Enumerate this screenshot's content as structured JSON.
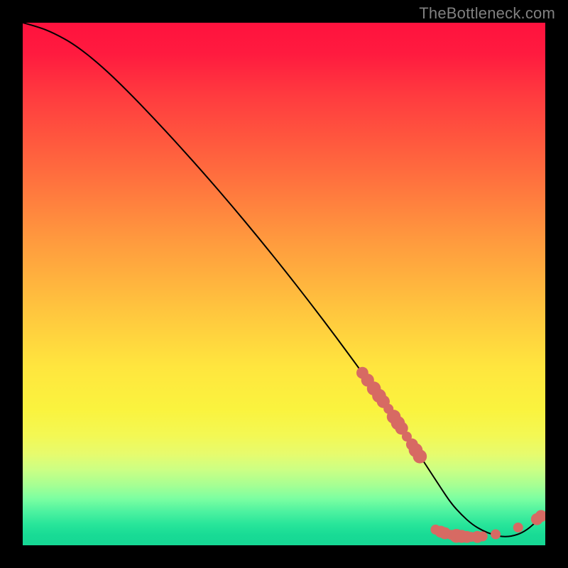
{
  "watermark": "TheBottleneck.com",
  "colors": {
    "marker_fill": "#d76a63",
    "marker_stroke": "#d76a63",
    "curve_stroke": "#000000",
    "frame_bg": "#000000"
  },
  "chart_data": {
    "type": "line",
    "title": "",
    "xlabel": "",
    "ylabel": "",
    "xlim": [
      0,
      100
    ],
    "ylim": [
      0,
      100
    ],
    "grid": false,
    "legend": false,
    "series": [
      {
        "name": "bottleneck-curve",
        "x": [
          0,
          3,
          6,
          10,
          15,
          20,
          25,
          30,
          35,
          40,
          45,
          50,
          55,
          60,
          65,
          70,
          74,
          77,
          80,
          82,
          84,
          86,
          88,
          90,
          92,
          94,
          96,
          98,
          100
        ],
        "y": [
          100,
          99.2,
          98.0,
          95.8,
          91.8,
          87.0,
          81.8,
          76.4,
          70.8,
          65.0,
          59.0,
          52.8,
          46.4,
          39.8,
          33.0,
          26.0,
          20.2,
          15.6,
          11.0,
          8.0,
          5.8,
          4.0,
          2.8,
          2.0,
          1.6,
          1.8,
          2.6,
          4.2,
          6.2
        ]
      }
    ],
    "markers": [
      {
        "x": 65.0,
        "y": 33.0,
        "r": 1.2
      },
      {
        "x": 66.0,
        "y": 31.6,
        "r": 1.3
      },
      {
        "x": 67.2,
        "y": 30.0,
        "r": 1.4
      },
      {
        "x": 68.2,
        "y": 28.6,
        "r": 1.4
      },
      {
        "x": 69.0,
        "y": 27.5,
        "r": 1.3
      },
      {
        "x": 70.0,
        "y": 26.1,
        "r": 1.0
      },
      {
        "x": 71.0,
        "y": 24.6,
        "r": 1.4
      },
      {
        "x": 71.8,
        "y": 23.4,
        "r": 1.4
      },
      {
        "x": 72.5,
        "y": 22.4,
        "r": 1.3
      },
      {
        "x": 73.5,
        "y": 20.8,
        "r": 1.0
      },
      {
        "x": 74.5,
        "y": 19.3,
        "r": 1.2
      },
      {
        "x": 75.2,
        "y": 18.2,
        "r": 1.4
      },
      {
        "x": 76.0,
        "y": 17.0,
        "r": 1.4
      },
      {
        "x": 79.0,
        "y": 3.0,
        "r": 1.0
      },
      {
        "x": 80.0,
        "y": 2.6,
        "r": 1.2
      },
      {
        "x": 80.8,
        "y": 2.3,
        "r": 1.2
      },
      {
        "x": 82.0,
        "y": 2.0,
        "r": 1.0
      },
      {
        "x": 83.0,
        "y": 1.8,
        "r": 1.4
      },
      {
        "x": 84.0,
        "y": 1.7,
        "r": 1.3
      },
      {
        "x": 85.0,
        "y": 1.6,
        "r": 1.2
      },
      {
        "x": 85.8,
        "y": 1.6,
        "r": 1.0
      },
      {
        "x": 87.0,
        "y": 1.6,
        "r": 1.2
      },
      {
        "x": 88.0,
        "y": 1.7,
        "r": 1.0
      },
      {
        "x": 90.5,
        "y": 2.1,
        "r": 1.0
      },
      {
        "x": 94.8,
        "y": 3.4,
        "r": 1.0
      },
      {
        "x": 98.4,
        "y": 5.0,
        "r": 1.2
      },
      {
        "x": 99.2,
        "y": 5.6,
        "r": 1.2
      }
    ]
  }
}
